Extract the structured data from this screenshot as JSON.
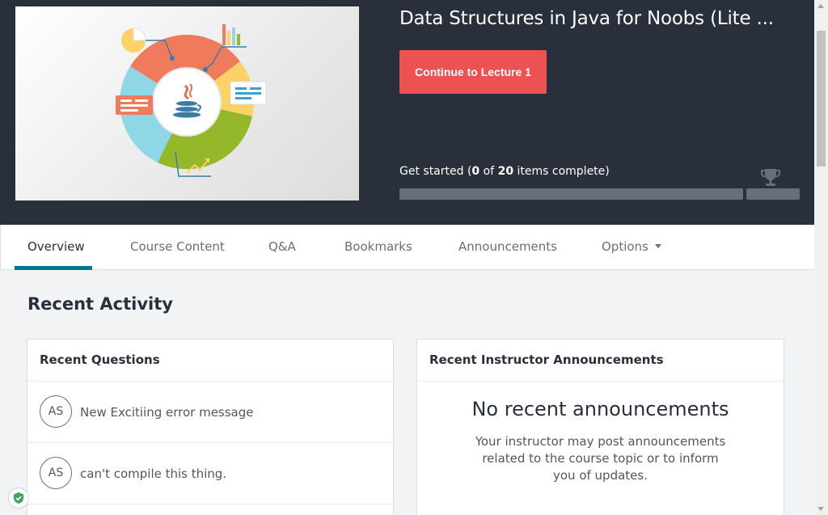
{
  "course": {
    "title": "Data Structures in Java for Noobs (Lite ...",
    "cta_label": "Continue to Lecture 1",
    "progress": {
      "prefix": "Get started (",
      "completed": "0",
      "middle": " of ",
      "total": "20",
      "suffix": " items complete)",
      "fraction": 0
    }
  },
  "tabs": [
    {
      "label": "Overview",
      "active": true
    },
    {
      "label": "Course Content"
    },
    {
      "label": "Q&A"
    },
    {
      "label": "Bookmarks"
    },
    {
      "label": "Announcements"
    },
    {
      "label": "Options",
      "has_dropdown": true
    }
  ],
  "recent_activity": {
    "title": "Recent Activity",
    "questions": {
      "heading": "Recent Questions",
      "items": [
        {
          "initials": "AS",
          "text": "New Excitiing error message"
        },
        {
          "initials": "AS",
          "text": "can't compile this thing."
        }
      ]
    },
    "announcements": {
      "heading": "Recent Instructor Announcements",
      "empty_title": "No recent announcements",
      "empty_body": "Your instructor may post announcements related to the course topic or to inform you of updates."
    }
  },
  "icons": {
    "trophy": "trophy-icon",
    "caret": "caret-down-icon",
    "shield": "shield-check-icon",
    "java": "java-cup-logo"
  },
  "colors": {
    "header_bg": "#29303b",
    "cta": "#ec5252",
    "accent": "#007791",
    "progress_track": "#686f7a"
  }
}
